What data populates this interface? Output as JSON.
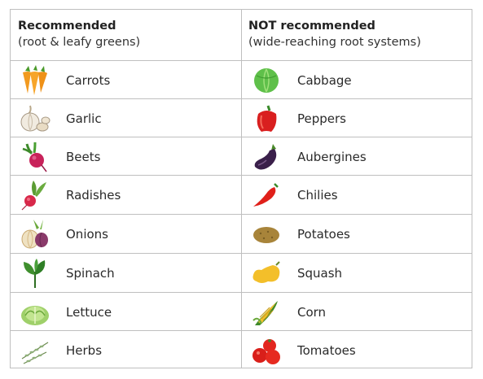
{
  "columns": [
    {
      "title": "Recommended",
      "subtitle": "(root & leafy greens)"
    },
    {
      "title": "NOT recommended",
      "subtitle": "(wide-reaching root systems)"
    }
  ],
  "recommended": [
    {
      "label": "Carrots",
      "icon": "carrot-icon"
    },
    {
      "label": "Garlic",
      "icon": "garlic-icon"
    },
    {
      "label": "Beets",
      "icon": "beet-icon"
    },
    {
      "label": "Radishes",
      "icon": "radish-icon"
    },
    {
      "label": "Onions",
      "icon": "onion-icon"
    },
    {
      "label": "Spinach",
      "icon": "spinach-icon"
    },
    {
      "label": "Lettuce",
      "icon": "lettuce-icon"
    },
    {
      "label": "Herbs",
      "icon": "herbs-icon"
    }
  ],
  "not_recommended": [
    {
      "label": "Cabbage",
      "icon": "cabbage-icon"
    },
    {
      "label": "Peppers",
      "icon": "pepper-icon"
    },
    {
      "label": "Aubergines",
      "icon": "aubergine-icon"
    },
    {
      "label": "Chilies",
      "icon": "chili-icon"
    },
    {
      "label": "Potatoes",
      "icon": "potato-icon"
    },
    {
      "label": "Squash",
      "icon": "squash-icon"
    },
    {
      "label": "Corn",
      "icon": "corn-icon"
    },
    {
      "label": "Tomatoes",
      "icon": "tomato-icon"
    }
  ]
}
